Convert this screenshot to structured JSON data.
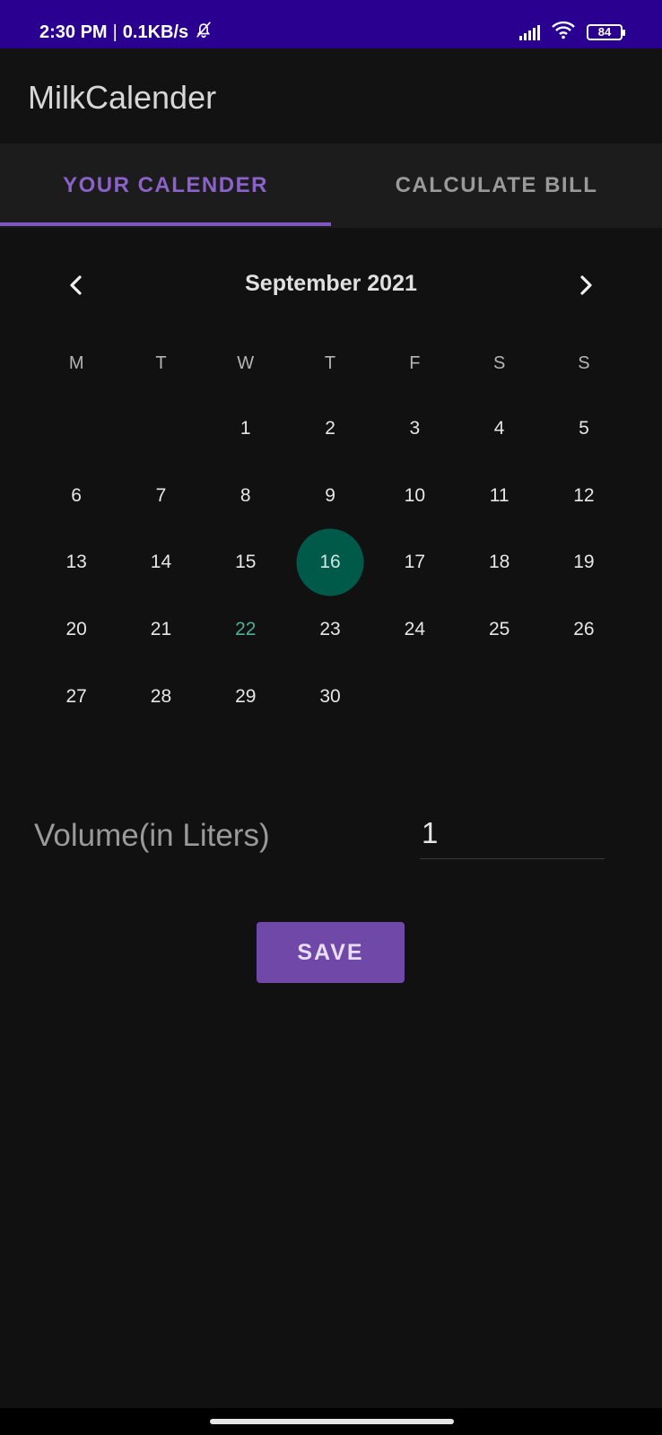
{
  "status_bar": {
    "time": "2:30 PM",
    "separator": "|",
    "network_speed": "0.1KB/s",
    "battery_level": "84"
  },
  "app_bar": {
    "title": "MilkCalender"
  },
  "tabs": [
    {
      "label": "YOUR CALENDER",
      "active": true
    },
    {
      "label": "CALCULATE BILL",
      "active": false
    }
  ],
  "calendar": {
    "month_label": "September 2021",
    "weekdays": [
      "M",
      "T",
      "W",
      "T",
      "F",
      "S",
      "S"
    ],
    "weeks": [
      [
        "",
        "",
        "1",
        "2",
        "3",
        "4",
        "5"
      ],
      [
        "6",
        "7",
        "8",
        "9",
        "10",
        "11",
        "12"
      ],
      [
        "13",
        "14",
        "15",
        "16",
        "17",
        "18",
        "19"
      ],
      [
        "20",
        "21",
        "22",
        "23",
        "24",
        "25",
        "26"
      ],
      [
        "27",
        "28",
        "29",
        "30",
        "",
        "",
        ""
      ]
    ],
    "selected_day": "16",
    "today": "22"
  },
  "volume": {
    "label": "Volume(in Liters)",
    "value": "1"
  },
  "save_label": "SAVE",
  "colors": {
    "status_bar": "#2a0090",
    "accent_purple": "#7e57c2",
    "selected_circle": "#005a4a",
    "today_text": "#4fae96",
    "background": "#111111"
  }
}
